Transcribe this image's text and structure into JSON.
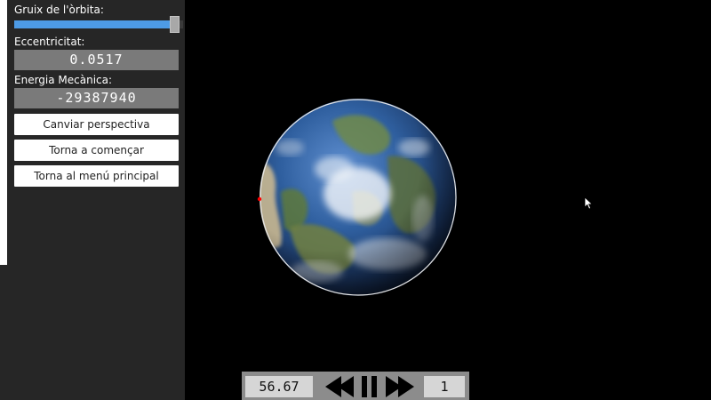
{
  "panel": {
    "orbit_width_label": "Gruix de l'òrbita",
    "orbit_width_colon": ":",
    "orbit_width_level": 0.95,
    "eccentricity_label": "Eccentricitat:",
    "eccentricity_value": "0.0517",
    "energy_label": "Energia Mecànica:",
    "energy_value": "-29387940",
    "buttons": {
      "change_perspective": "Canviar perspectiva",
      "restart": "Torna a començar",
      "main_menu": "Torna al menú principal"
    }
  },
  "playback": {
    "time_value": "56.67",
    "speed_value": "1"
  },
  "colors": {
    "panel_bg": "#262626",
    "slider_fill": "#4d9be6",
    "readout_bg": "#7a7a7a",
    "controls_bg": "#8c8c8c",
    "orbit_line": "#e6e6e6",
    "satellite": "#ff0000"
  },
  "icons": {
    "rewind": "rewind-icon",
    "pause": "pause-icon",
    "fast_forward": "fast-forward-icon",
    "cursor": "mouse-cursor-icon"
  }
}
